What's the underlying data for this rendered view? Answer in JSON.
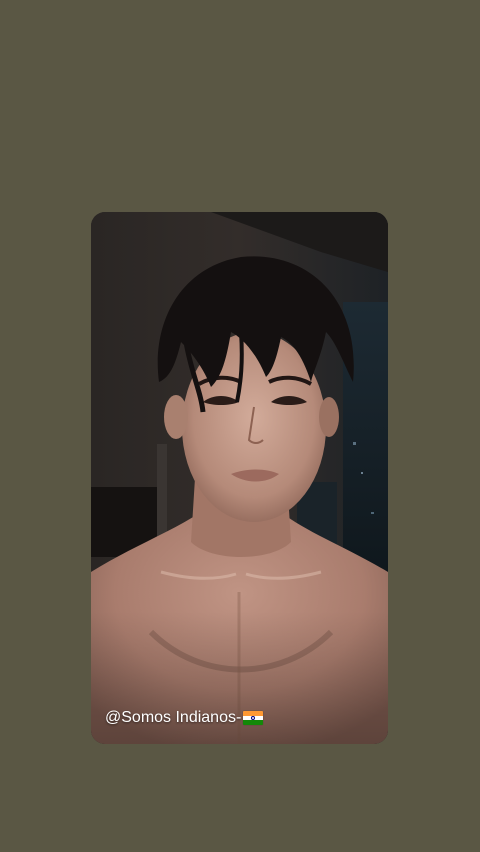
{
  "story": {
    "mention_text": "@Somos Indianos-",
    "flag_icon": "india-flag-icon"
  },
  "colors": {
    "background": "#5a5744",
    "card_background": "#2b2624",
    "text": "#ffffff"
  }
}
